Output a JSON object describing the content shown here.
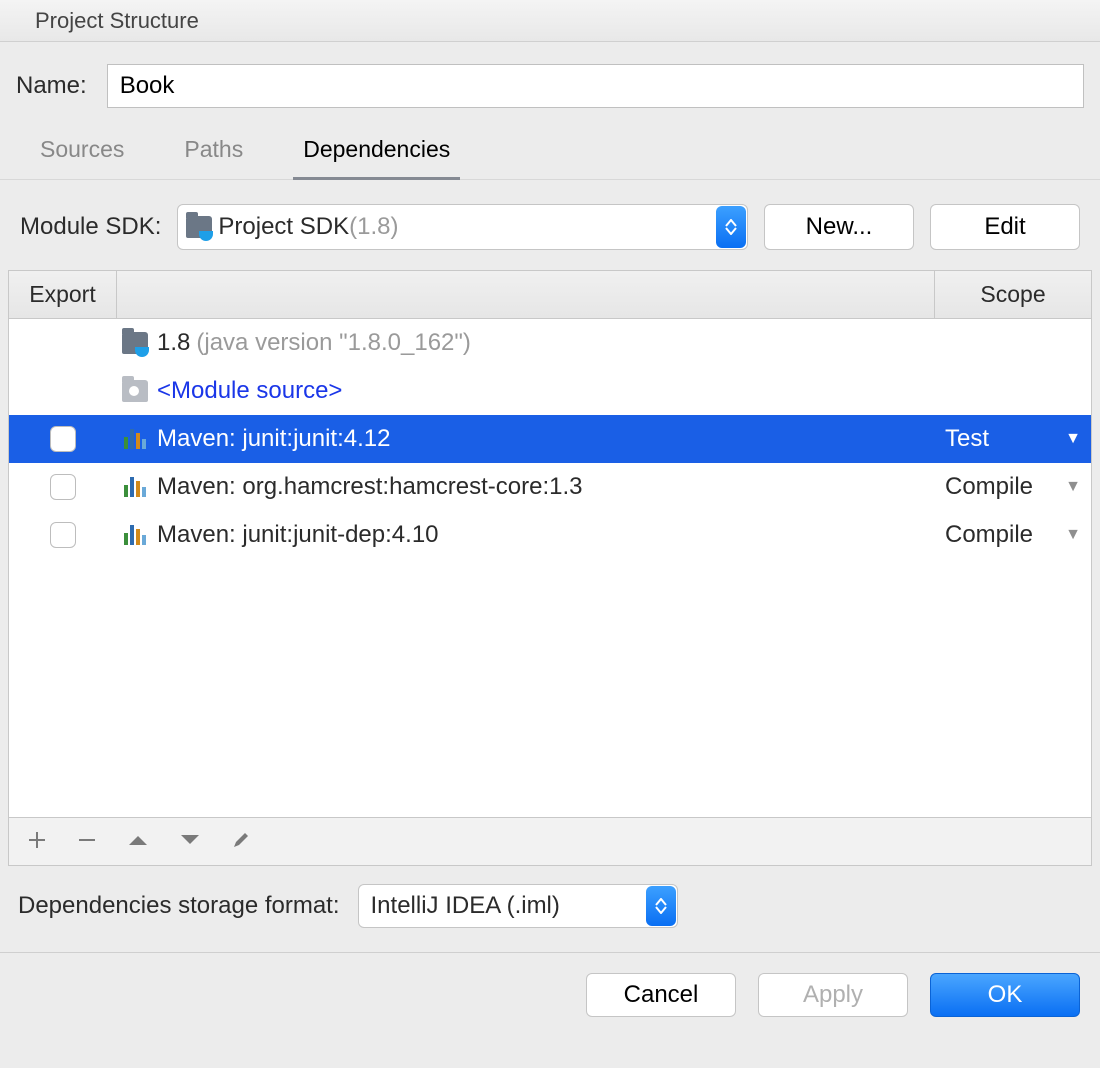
{
  "title": "Project Structure",
  "name_label": "Name:",
  "name_value": "Book",
  "tabs": {
    "sources": "Sources",
    "paths": "Paths",
    "dependencies": "Dependencies"
  },
  "sdk": {
    "label": "Module SDK:",
    "selected_prefix": "Project SDK ",
    "selected_version": "(1.8)",
    "new_btn": "New...",
    "edit_btn": "Edit"
  },
  "table": {
    "export_header": "Export",
    "scope_header": "Scope"
  },
  "rows": [
    {
      "type": "jdk",
      "label_main": "1.8 ",
      "label_gray": "(java version \"1.8.0_162\")"
    },
    {
      "type": "module",
      "label_link": "<Module source>"
    },
    {
      "type": "lib",
      "checkbox": true,
      "label": "Maven: junit:junit:4.12",
      "scope": "Test",
      "selected": true
    },
    {
      "type": "lib",
      "checkbox": true,
      "label": "Maven: org.hamcrest:hamcrest-core:1.3",
      "scope": "Compile"
    },
    {
      "type": "lib",
      "checkbox": true,
      "label": "Maven: junit:junit-dep:4.10",
      "scope": "Compile"
    }
  ],
  "storage": {
    "label": "Dependencies storage format:",
    "value": "IntelliJ IDEA (.iml)"
  },
  "footer": {
    "cancel": "Cancel",
    "apply": "Apply",
    "ok": "OK"
  }
}
